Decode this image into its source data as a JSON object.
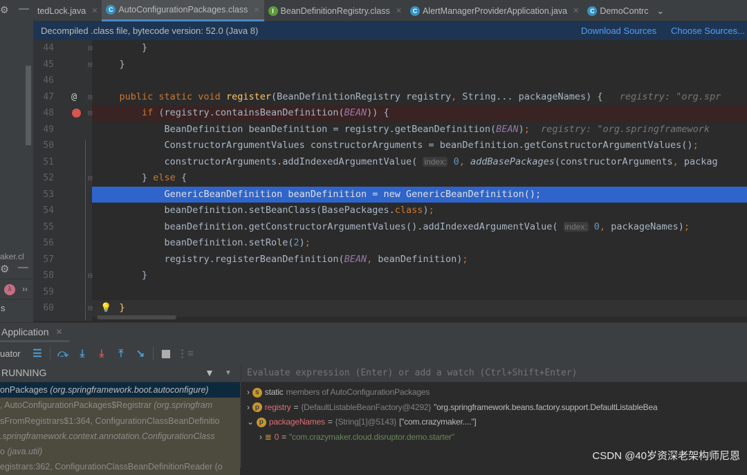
{
  "tabs": [
    {
      "label": "tedLock.java",
      "icon": "none",
      "active": false
    },
    {
      "label": "AutoConfigurationPackages.class",
      "icon": "class-icon",
      "active": true
    },
    {
      "label": "BeanDefinitionRegistry.class",
      "icon": "interface-icon",
      "active": false
    },
    {
      "label": "AlertManagerProviderApplication.java",
      "icon": "spring-boot-class-icon",
      "active": false
    },
    {
      "label": "DemoContrc",
      "icon": "class-icon",
      "active": false
    }
  ],
  "banner": {
    "text": "Decompiled .class file, bytecode version: 52.0 (Java 8)",
    "download": "Download Sources",
    "choose": "Choose Sources..."
  },
  "left_panel": {
    "truncated_label": "aker.cl",
    "bottom_label": "s"
  },
  "colors": {
    "keyword": "#cc7832",
    "method": "#ffc66d",
    "constant": "#9876aa",
    "number": "#6897bb",
    "selection": "#2f65ca",
    "breakpoint_line": "#3a2323"
  },
  "code": [
    {
      "n": "44",
      "ind": 8,
      "t": [
        [
          "",
          "}"
        ]
      ]
    },
    {
      "n": "45",
      "ind": 4,
      "t": [
        [
          "",
          "}"
        ]
      ]
    },
    {
      "n": "46",
      "ind": 0,
      "t": []
    },
    {
      "n": "47",
      "ind": 4,
      "mark": "@",
      "t": [
        [
          "k",
          "public static void "
        ],
        [
          "m",
          "register"
        ],
        [
          "",
          "(BeanDefinitionRegistry registry"
        ],
        [
          "k",
          ","
        ],
        [
          "",
          " String... packageNames) {   "
        ],
        [
          "h",
          "registry: \"org.spr"
        ]
      ]
    },
    {
      "n": "48",
      "ind": 8,
      "mark": "breakpoint",
      "t": [
        [
          "k",
          "if "
        ],
        [
          "",
          "(registry.containsBeanDefinition("
        ],
        [
          "c",
          "BEAN"
        ],
        [
          "",
          "))"
        ],
        [
          "",
          " {"
        ]
      ]
    },
    {
      "n": "49",
      "ind": 12,
      "t": [
        [
          "",
          "BeanDefinition beanDefinition = registry.getBeanDefinition("
        ],
        [
          "c",
          "BEAN"
        ],
        [
          "",
          ")"
        ],
        [
          "k",
          ";"
        ],
        [
          "",
          "  "
        ],
        [
          "h",
          "registry: \"org.springframework"
        ]
      ]
    },
    {
      "n": "50",
      "ind": 12,
      "t": [
        [
          "",
          "ConstructorArgumentValues constructorArguments = beanDefinition.getConstructorArgumentValues()"
        ],
        [
          "k",
          ";"
        ]
      ]
    },
    {
      "n": "51",
      "ind": 12,
      "t": [
        [
          "",
          "constructorArguments.addIndexedArgumentValue( "
        ],
        [
          "p",
          "index:"
        ],
        [
          "n",
          " 0"
        ],
        [
          "k",
          ", "
        ],
        [
          "f",
          "addBasePackages"
        ],
        [
          "",
          "(constructorArguments"
        ],
        [
          "k",
          ", "
        ],
        [
          "",
          "packag"
        ]
      ]
    },
    {
      "n": "52",
      "ind": 8,
      "t": [
        [
          "",
          "} "
        ],
        [
          "k",
          "else "
        ],
        [
          "",
          "{"
        ]
      ]
    },
    {
      "n": "53",
      "ind": 12,
      "sel": true,
      "t": [
        [
          "",
          "GenericBeanDefinition beanDefinition = "
        ],
        [
          "k",
          "new "
        ],
        [
          "",
          "GenericBeanDefinition()"
        ],
        [
          "k",
          ";"
        ]
      ]
    },
    {
      "n": "54",
      "ind": 12,
      "t": [
        [
          "",
          "beanDefinition.setBeanClass(BasePackages."
        ],
        [
          "k",
          "class"
        ],
        [
          "",
          ")"
        ],
        [
          "k",
          ";"
        ]
      ]
    },
    {
      "n": "55",
      "ind": 12,
      "t": [
        [
          "",
          "beanDefinition.getConstructorArgumentValues().addIndexedArgumentValue( "
        ],
        [
          "p",
          "index:"
        ],
        [
          "n",
          " 0"
        ],
        [
          "k",
          ", "
        ],
        [
          "",
          "packageNames)"
        ],
        [
          "k",
          ";"
        ]
      ]
    },
    {
      "n": "56",
      "ind": 12,
      "t": [
        [
          "",
          "beanDefinition.setRole("
        ],
        [
          "n",
          "2"
        ],
        [
          "",
          ")"
        ],
        [
          "k",
          ";"
        ]
      ]
    },
    {
      "n": "57",
      "ind": 12,
      "t": [
        [
          "",
          "registry.registerBeanDefinition("
        ],
        [
          "c",
          "BEAN"
        ],
        [
          "k",
          ", "
        ],
        [
          "",
          "beanDefinition)"
        ],
        [
          "k",
          ";"
        ]
      ]
    },
    {
      "n": "58",
      "ind": 8,
      "t": [
        [
          "",
          "}"
        ]
      ]
    },
    {
      "n": "59",
      "ind": 0,
      "t": []
    },
    {
      "n": "60",
      "ind": 4,
      "cur": true,
      "mark": "bulb",
      "t": [
        [
          "m",
          "}"
        ]
      ]
    }
  ],
  "debug": {
    "tab": "Application",
    "evaluator_label": "uator",
    "thread_status": "RUNNING",
    "eval_placeholder": "Evaluate expression (Enter) or add a watch (Ctrl+Shift+Enter)"
  },
  "frames": [
    {
      "a": "onPackages ",
      "b": "(org.springframework.boot.autoconfigure)",
      "sel": true
    },
    {
      "a": ", AutoConfigurationPackages$Registrar ",
      "b": "(org.springfram"
    },
    {
      "a": "sFromRegistrars$1:364, ConfigurationClassBeanDefinitio",
      "b": ""
    },
    {
      "a": "",
      "b": ".springframework.context.annotation.ConfigurationClass"
    },
    {
      "a": "o ",
      "b": "(java.util)"
    },
    {
      "a": "egistrars:362, ConfigurationClassBeanDefinitionReader (o",
      "b": ""
    }
  ],
  "variables": [
    {
      "badge": "s",
      "name": "static",
      "rest": "members of AutoConfigurationPackages",
      "expand": "›"
    },
    {
      "badge": "p",
      "name": "registry",
      "type": "{DefaultListableBeanFactory@4292}",
      "value": "\"org.springframework.beans.factory.support.DefaultListableBea",
      "expand": "›"
    },
    {
      "badge": "p",
      "name": "packageNames",
      "type": "{String[1]@5143}",
      "value": "[\"com.crazymaker....\"]",
      "expand": "⌄"
    },
    {
      "badge": "array-item",
      "name": "0",
      "value": "\"com.crazymaker.cloud.disruptor.demo.starter\"",
      "expand": "›"
    }
  ],
  "watermark": "CSDN @40岁资深老架构师尼恩"
}
